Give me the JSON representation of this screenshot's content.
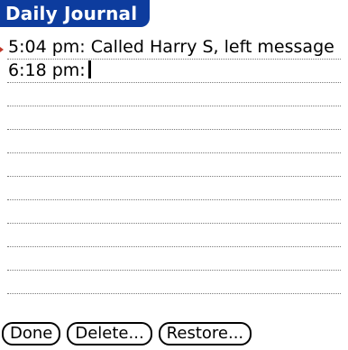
{
  "window": {
    "title": "Daily Journal"
  },
  "entries": [
    "5:04 pm: Called Harry S, left message",
    "6:18 pm:"
  ],
  "buttons": {
    "done": "Done",
    "delete": "Delete...",
    "restore": "Restore..."
  },
  "colors": {
    "title_bar": "#0d3c9e",
    "edge_mark": "#c0392b"
  }
}
